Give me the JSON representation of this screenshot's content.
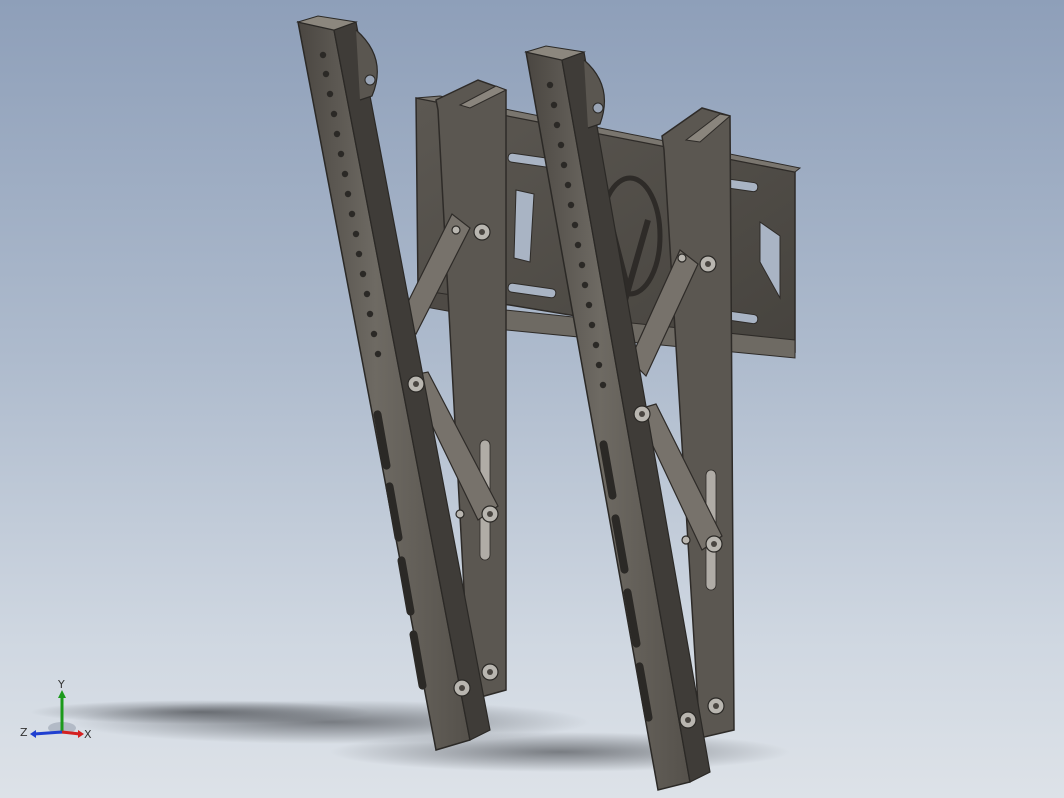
{
  "viewport": {
    "background_top": "#8e9fb9",
    "background_bottom": "#dde2e8"
  },
  "model": {
    "part_color": "#6b6760",
    "part_dark": "#3a3733",
    "part_light": "#8c877e",
    "hardware_color": "#b9b6b0"
  },
  "triad": {
    "x_label": "X",
    "y_label": "Y",
    "z_label": "Z",
    "x_color": "#d42020",
    "y_color": "#1c9a1c",
    "z_color": "#1f3fd0"
  }
}
